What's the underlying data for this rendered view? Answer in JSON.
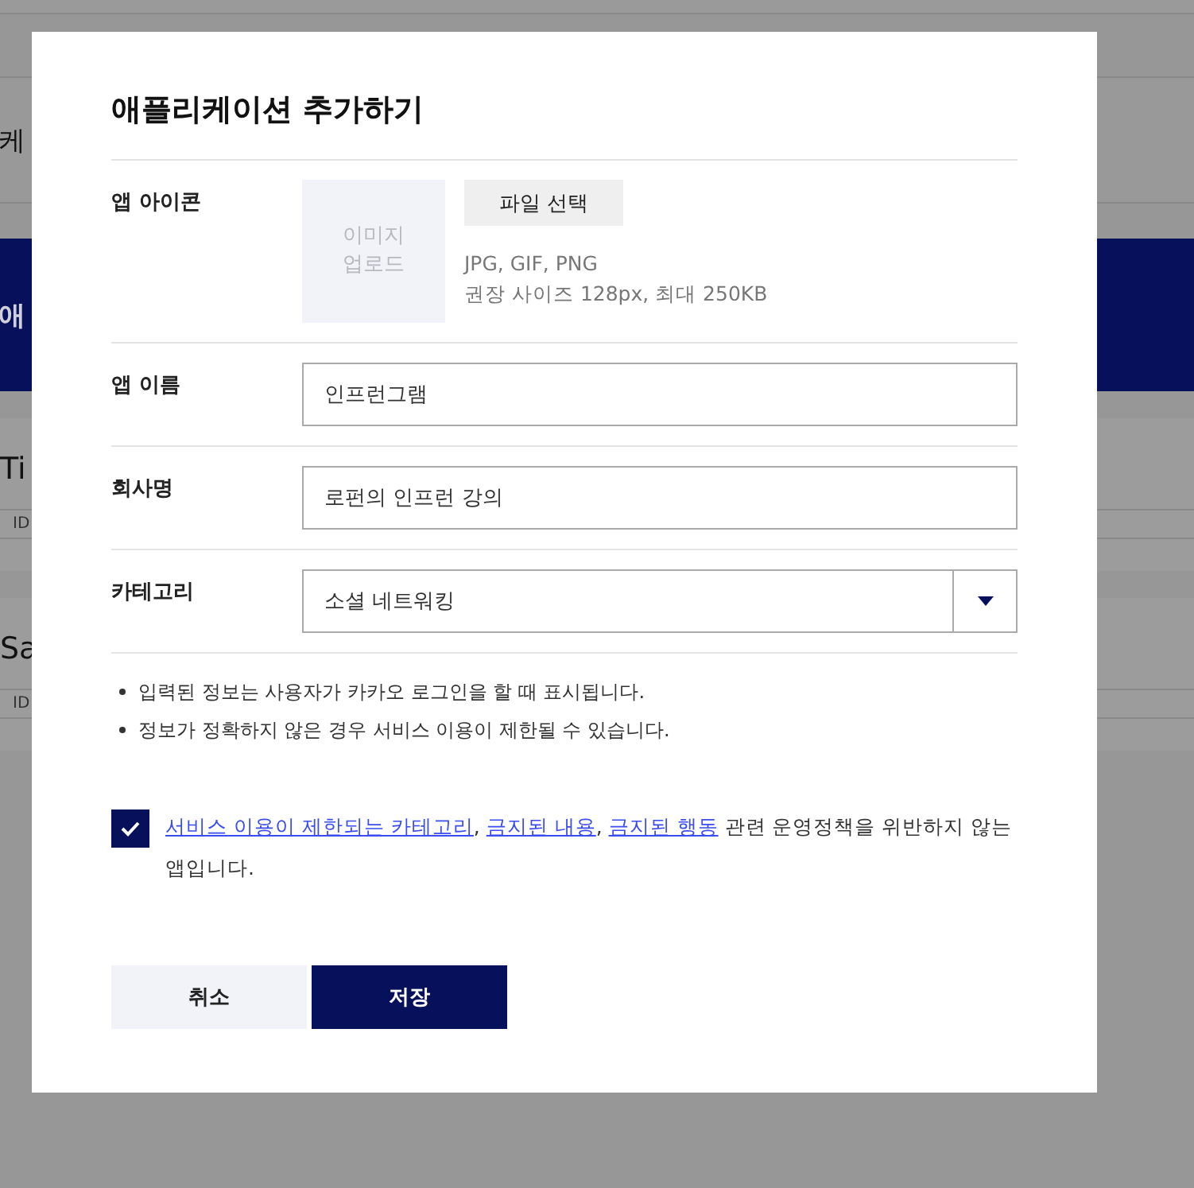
{
  "background": {
    "header_title": "케",
    "banner_title": "애",
    "cards": [
      {
        "title": "Ti",
        "meta": "ID"
      },
      {
        "title": "Sa",
        "meta": "ID"
      }
    ]
  },
  "dialog": {
    "title": "애플리케이션 추가하기",
    "icon_row": {
      "label": "앱 아이콘",
      "placeholder": "이미지\n업로드",
      "button": "파일 선택",
      "hints": [
        "JPG, GIF, PNG",
        "권장 사이즈 128px, 최대 250KB"
      ]
    },
    "fields": [
      {
        "kind": "input",
        "label": "앱 이름",
        "value": "인프런그램"
      },
      {
        "kind": "input",
        "label": "회사명",
        "value": "로펀의 인프런 강의"
      },
      {
        "kind": "select",
        "label": "카테고리",
        "value": "소셜 네트워킹"
      }
    ],
    "notes": [
      "입력된 정보는 사용자가 카카오 로그인을 할 때 표시됩니다.",
      "정보가 정확하지 않은 경우 서비스 이용이 제한될 수 있습니다."
    ],
    "agreement": {
      "checked": true,
      "parts": [
        {
          "kind": "link",
          "text": "서비스 이용이 제한되는 카테고리"
        },
        {
          "kind": "text",
          "text": ", "
        },
        {
          "kind": "link",
          "text": "금지된 내용"
        },
        {
          "kind": "text",
          "text": ", "
        },
        {
          "kind": "link",
          "text": "금지된 행동"
        },
        {
          "kind": "text",
          "text": " 관련 운영정책을 위반하지 않는 앱입니다."
        }
      ]
    },
    "buttons": [
      {
        "kind": "secondary",
        "label": "취소"
      },
      {
        "kind": "primary",
        "label": "저장"
      }
    ]
  }
}
